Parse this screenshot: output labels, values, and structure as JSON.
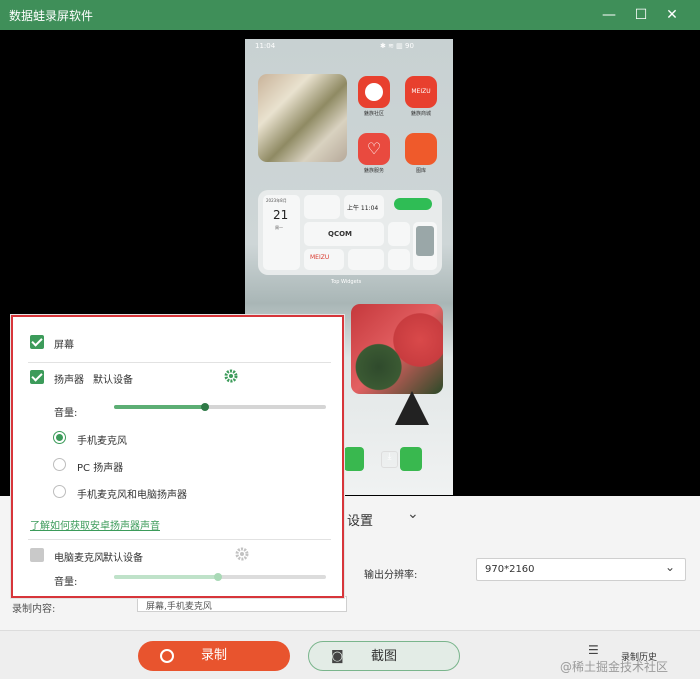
{
  "window": {
    "title": "数据蛙录屏软件",
    "minimize": "—",
    "maximize": "☐",
    "close": "✕"
  },
  "phone": {
    "status_time": "11:04",
    "status_right": "✱ ≋ ▥ 90",
    "apps": [
      {
        "label": "魅族社区",
        "icon": "meizu-community-icon",
        "color": "#e8402e"
      },
      {
        "label": "魅族商城",
        "icon": "meizu-store-icon",
        "color": "#e8402e",
        "badge": "MEIZU"
      },
      {
        "label": "魅族服务",
        "icon": "heart-service-icon",
        "color": "#e94a3f"
      },
      {
        "label": "图库",
        "icon": "gallery-icon",
        "color": "#ef5a2b"
      }
    ],
    "widget": {
      "date_small": "2023年8月",
      "day": "21",
      "weekday": "周一",
      "time": "上午 11:04",
      "brand": "QCOM",
      "meizu": "MEIZU",
      "caption": "Top Widgets"
    }
  },
  "settings": {
    "header": "设置",
    "resolution_label": "输出分辨率:",
    "resolution_value": "970*2160",
    "content_label": "录制内容:",
    "content_value": "屏幕,手机麦克风"
  },
  "panel": {
    "screen": {
      "label": "屏幕",
      "checked": true
    },
    "speaker": {
      "label": "扬声器",
      "device": "默认设备",
      "checked": true,
      "volume_label": "音量:",
      "volume": 0.43
    },
    "radios": [
      {
        "label": "手机麦克风",
        "selected": true
      },
      {
        "label": "PC 扬声器",
        "selected": false
      },
      {
        "label": "手机麦克风和电脑扬声器",
        "selected": false
      }
    ],
    "help_link": "了解如何获取安卓扬声器声音",
    "mic": {
      "label": "电脑麦克风",
      "device": "默认设备",
      "checked": false,
      "volume_label": "音量:",
      "volume": 0.49
    }
  },
  "bottom": {
    "record": "录制",
    "screenshot": "截图",
    "history": "录制历史",
    "watermark": "@稀土掘金技术社区"
  },
  "colors": {
    "brand": "#3f8f59",
    "accent": "#3c9b5a",
    "record": "#e8542e",
    "highlight_border": "#d7353a"
  }
}
